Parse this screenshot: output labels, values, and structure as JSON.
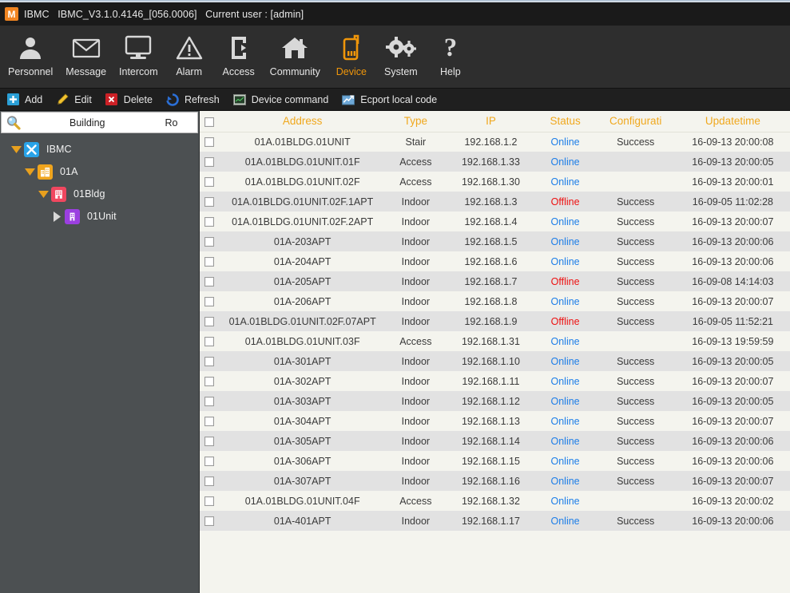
{
  "window": {
    "logo_letter": "M",
    "title_parts": [
      "IBMC",
      "IBMC_V3.1.0.4146_[056.0006]",
      "Current user : [admin]"
    ],
    "title_full": "IBMC  IBMC_V3.1.0.4146_[056.0006]  Current user : [admin]"
  },
  "colors": {
    "accent_orange": "#f0960a",
    "header_orange": "#f0a81e",
    "status_online": "#1d7ee8",
    "status_offline": "#ee1111",
    "titlebar_bg": "#1a1a1a",
    "mainnav_bg": "#2e2e2e",
    "actionbar_bg": "#1f1f1f",
    "sidebar_bg": "#4c5052",
    "grid_bg_odd": "#f4f4ee",
    "grid_bg_even": "#e2e2e2"
  },
  "mainnav": {
    "active": "Device",
    "items": [
      {
        "label": "Personnel",
        "icon": "user-icon"
      },
      {
        "label": "Message",
        "icon": "envelope-icon"
      },
      {
        "label": "Intercom",
        "icon": "monitor-icon"
      },
      {
        "label": "Alarm",
        "icon": "warning-triangle-icon"
      },
      {
        "label": "Access",
        "icon": "door-access-icon"
      },
      {
        "label": "Community",
        "icon": "house-icon"
      },
      {
        "label": "Device",
        "icon": "mobile-phone-icon"
      },
      {
        "label": "System",
        "icon": "gears-icon"
      },
      {
        "label": "Help",
        "icon": "question-mark-icon"
      }
    ]
  },
  "actionbar": {
    "items": [
      {
        "label": "Add",
        "icon": "add-plus-icon"
      },
      {
        "label": "Edit",
        "icon": "pencil-icon"
      },
      {
        "label": "Delete",
        "icon": "delete-x-icon"
      },
      {
        "label": "Refresh",
        "icon": "refresh-icon"
      },
      {
        "label": "Device command",
        "icon": "terminal-window-icon"
      },
      {
        "label": "Ecport local code",
        "icon": "chart-export-icon"
      }
    ]
  },
  "sidebar": {
    "search": {
      "icon": "search-icon",
      "col1": "Building",
      "col2": "Ro"
    },
    "tree": [
      {
        "label": "IBMC",
        "indent": 0,
        "expanded": true,
        "icon": "ibmc-root-icon",
        "icon_color": "#29a3e8"
      },
      {
        "label": "01A",
        "indent": 1,
        "expanded": true,
        "icon": "community-icon",
        "icon_color": "#f0a51e"
      },
      {
        "label": "01Bldg",
        "indent": 2,
        "expanded": true,
        "icon": "building-icon",
        "icon_color": "#f0475f"
      },
      {
        "label": "01Unit",
        "indent": 3,
        "expanded": false,
        "icon": "unit-icon",
        "icon_color": "#9b3fe0"
      }
    ]
  },
  "table": {
    "select_all_checkbox": false,
    "columns": [
      "",
      "Address",
      "Type",
      "IP",
      "Status",
      "Configurati",
      "Updatetime"
    ],
    "rows": [
      {
        "address": "01A.01BLDG.01UNIT",
        "type": "Stair",
        "ip": "192.168.1.2",
        "status": "Online",
        "config": "Success",
        "updatetime": "16-09-13 20:00:08"
      },
      {
        "address": "01A.01BLDG.01UNIT.01F",
        "type": "Access",
        "ip": "192.168.1.33",
        "status": "Online",
        "config": "",
        "updatetime": "16-09-13 20:00:05"
      },
      {
        "address": "01A.01BLDG.01UNIT.02F",
        "type": "Access",
        "ip": "192.168.1.30",
        "status": "Online",
        "config": "",
        "updatetime": "16-09-13 20:00:01"
      },
      {
        "address": "01A.01BLDG.01UNIT.02F.1APT",
        "type": "Indoor",
        "ip": "192.168.1.3",
        "status": "Offline",
        "config": "Success",
        "updatetime": "16-09-05 11:02:28"
      },
      {
        "address": "01A.01BLDG.01UNIT.02F.2APT",
        "type": "Indoor",
        "ip": "192.168.1.4",
        "status": "Online",
        "config": "Success",
        "updatetime": "16-09-13 20:00:07"
      },
      {
        "address": "01A-203APT",
        "type": "Indoor",
        "ip": "192.168.1.5",
        "status": "Online",
        "config": "Success",
        "updatetime": "16-09-13 20:00:06"
      },
      {
        "address": "01A-204APT",
        "type": "Indoor",
        "ip": "192.168.1.6",
        "status": "Online",
        "config": "Success",
        "updatetime": "16-09-13 20:00:06"
      },
      {
        "address": "01A-205APT",
        "type": "Indoor",
        "ip": "192.168.1.7",
        "status": "Offline",
        "config": "Success",
        "updatetime": "16-09-08 14:14:03"
      },
      {
        "address": "01A-206APT",
        "type": "Indoor",
        "ip": "192.168.1.8",
        "status": "Online",
        "config": "Success",
        "updatetime": "16-09-13 20:00:07"
      },
      {
        "address": "01A.01BLDG.01UNIT.02F.07APT",
        "type": "Indoor",
        "ip": "192.168.1.9",
        "status": "Offline",
        "config": "Success",
        "updatetime": "16-09-05 11:52:21"
      },
      {
        "address": "01A.01BLDG.01UNIT.03F",
        "type": "Access",
        "ip": "192.168.1.31",
        "status": "Online",
        "config": "",
        "updatetime": "16-09-13 19:59:59"
      },
      {
        "address": "01A-301APT",
        "type": "Indoor",
        "ip": "192.168.1.10",
        "status": "Online",
        "config": "Success",
        "updatetime": "16-09-13 20:00:05"
      },
      {
        "address": "01A-302APT",
        "type": "Indoor",
        "ip": "192.168.1.11",
        "status": "Online",
        "config": "Success",
        "updatetime": "16-09-13 20:00:07"
      },
      {
        "address": "01A-303APT",
        "type": "Indoor",
        "ip": "192.168.1.12",
        "status": "Online",
        "config": "Success",
        "updatetime": "16-09-13 20:00:05"
      },
      {
        "address": "01A-304APT",
        "type": "Indoor",
        "ip": "192.168.1.13",
        "status": "Online",
        "config": "Success",
        "updatetime": "16-09-13 20:00:07"
      },
      {
        "address": "01A-305APT",
        "type": "Indoor",
        "ip": "192.168.1.14",
        "status": "Online",
        "config": "Success",
        "updatetime": "16-09-13 20:00:06"
      },
      {
        "address": "01A-306APT",
        "type": "Indoor",
        "ip": "192.168.1.15",
        "status": "Online",
        "config": "Success",
        "updatetime": "16-09-13 20:00:06"
      },
      {
        "address": "01A-307APT",
        "type": "Indoor",
        "ip": "192.168.1.16",
        "status": "Online",
        "config": "Success",
        "updatetime": "16-09-13 20:00:07"
      },
      {
        "address": "01A.01BLDG.01UNIT.04F",
        "type": "Access",
        "ip": "192.168.1.32",
        "status": "Online",
        "config": "",
        "updatetime": "16-09-13 20:00:02"
      },
      {
        "address": "01A-401APT",
        "type": "Indoor",
        "ip": "192.168.1.17",
        "status": "Online",
        "config": "Success",
        "updatetime": "16-09-13 20:00:06"
      }
    ]
  }
}
